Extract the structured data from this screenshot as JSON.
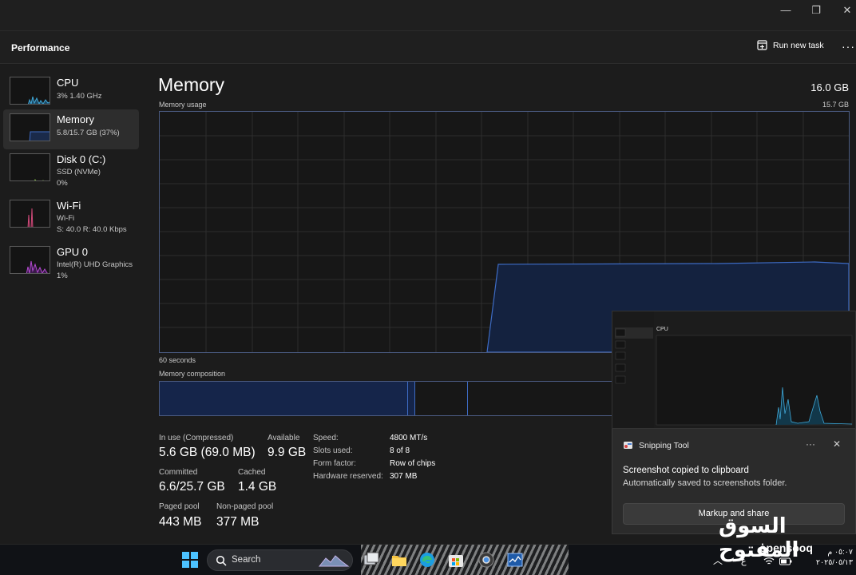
{
  "window": {
    "minimize_glyph": "—",
    "restore_glyph": "❐",
    "close_glyph": "✕"
  },
  "header": {
    "title": "Performance",
    "run_task_label": "Run new task",
    "more_label": "···"
  },
  "sidebar": {
    "items": [
      {
        "name": "CPU",
        "line1": "3%  1.40 GHz",
        "line2": "",
        "icon": "cpu-graph-thumb",
        "color": "#3fa8d8"
      },
      {
        "name": "Memory",
        "line1": "5.8/15.7 GB (37%)",
        "line2": "",
        "icon": "memory-graph-thumb",
        "color": "#2f5fb0"
      },
      {
        "name": "Disk 0 (C:)",
        "line1": "SSD (NVMe)",
        "line2": "0%",
        "icon": "disk-graph-thumb",
        "color": "#7cb342"
      },
      {
        "name": "Wi-Fi",
        "line1": "Wi-Fi",
        "line2": "S: 40.0  R: 40.0 Kbps",
        "icon": "wifi-graph-thumb",
        "color": "#d14a7a"
      },
      {
        "name": "GPU 0",
        "line1": "Intel(R) UHD Graphics",
        "line2": "1%",
        "icon": "gpu-graph-thumb",
        "color": "#b34ad1"
      }
    ]
  },
  "main": {
    "title": "Memory",
    "total": "16.0 GB",
    "usage_label": "Memory usage",
    "usage_max": "15.7 GB",
    "time_label": "60 seconds",
    "composition_label": "Memory composition",
    "colors": {
      "accent_fill": "#1a2a4a",
      "accent_line": "#3d6bc4"
    },
    "stats": {
      "in_use_label": "In use (Compressed)",
      "in_use_value": "5.6 GB (69.0 MB)",
      "available_label": "Available",
      "available_value": "9.9 GB",
      "committed_label": "Committed",
      "committed_value": "6.6/25.7 GB",
      "cached_label": "Cached",
      "cached_value": "1.4 GB",
      "paged_label": "Paged pool",
      "paged_value": "443 MB",
      "nonpaged_label": "Non-paged pool",
      "nonpaged_value": "377 MB"
    },
    "specs": [
      {
        "label": "Speed:",
        "value": "4800 MT/s"
      },
      {
        "label": "Slots used:",
        "value": "8 of 8"
      },
      {
        "label": "Form factor:",
        "value": "Row of chips"
      },
      {
        "label": "Hardware reserved:",
        "value": "307 MB"
      }
    ]
  },
  "snip_preview": {
    "title": "CPU"
  },
  "toast": {
    "app_name": "Snipping Tool",
    "heading": "Screenshot copied to clipboard",
    "body": "Automatically saved to screenshots folder.",
    "button": "Markup and share",
    "more": "···",
    "close": "✕"
  },
  "taskbar": {
    "search_placeholder": "Search",
    "watermark_arabic": "السوق المفتوح",
    "watermark_latin": "opensooq",
    "tray_lang": "ع",
    "time": "٠٥:٠٧ م",
    "date": "٢٠٢٥/٠٥/١٣"
  }
}
